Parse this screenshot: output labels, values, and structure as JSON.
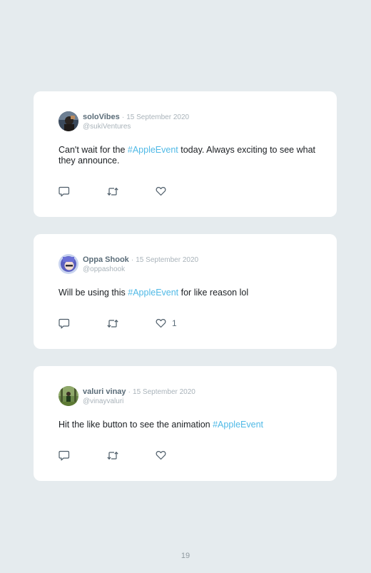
{
  "tweets": [
    {
      "name": "soloVibes",
      "separator": "·",
      "date": "15 September 2020",
      "handle": "@sukiVentures",
      "text_before": "Can't wait for the ",
      "hashtag": "#AppleEvent",
      "text_after": " today. Always exciting to see what they announce.",
      "like_count": ""
    },
    {
      "name": "Oppa Shook",
      "separator": "·",
      "date": "15 September 2020",
      "handle": "@oppashook",
      "text_before": "Will be using this ",
      "hashtag": "#AppleEvent",
      "text_after": " for like reason lol",
      "like_count": "1"
    },
    {
      "name": "valuri vinay",
      "separator": "·",
      "date": "15 September 2020",
      "handle": "@vinayvaluri",
      "text_before": "Hit the like button to see the animation ",
      "hashtag": "#AppleEvent",
      "text_after": "",
      "like_count": ""
    }
  ],
  "icons": {
    "reply": "comment-icon",
    "retweet": "retweet-icon",
    "like": "heart-icon"
  },
  "colors": {
    "background": "#e5ebee",
    "card": "#ffffff",
    "hashtag": "#4fb9e6",
    "name": "#5a6c78",
    "muted": "#a9b3ba"
  },
  "page_number": "19"
}
